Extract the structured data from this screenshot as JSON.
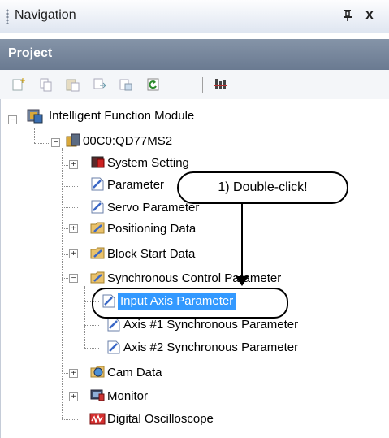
{
  "panel": {
    "title": "Navigation",
    "pin_glyph": "’",
    "close_glyph": "x"
  },
  "project_header": "Project",
  "toolbar": {
    "icons": [
      "new-item-icon",
      "copy-icon",
      "paste-icon",
      "move-icon",
      "rename-icon",
      "refresh-icon",
      "properties-icon"
    ]
  },
  "tree": {
    "root": "Intelligent Function Module",
    "module": "00C0:QD77MS2",
    "items": [
      "System Setting",
      "Parameter",
      "Servo Parameter",
      "Positioning Data",
      "Block Start Data",
      "Synchronous Control Parameter",
      "Input Axis Parameter",
      "Axis #1 Synchronous Parameter",
      "Axis #2 Synchronous Parameter",
      "Cam Data",
      "Monitor",
      "Digital Oscilloscope"
    ]
  },
  "callout": {
    "text": "1) Double-click!"
  },
  "colors": {
    "selection": "#3399ff",
    "header": "#6a7a91"
  }
}
